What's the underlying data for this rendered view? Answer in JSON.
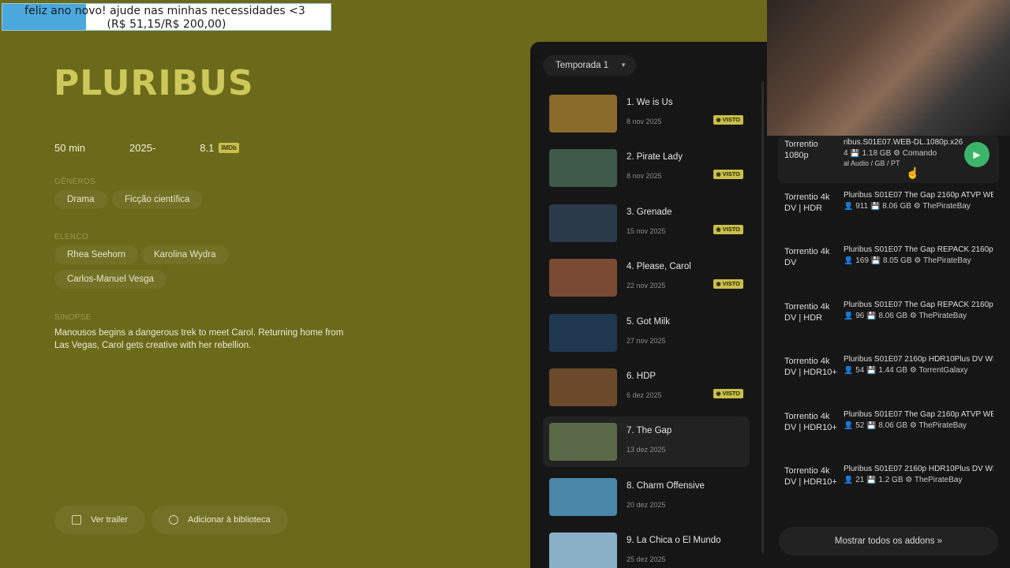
{
  "donation": {
    "line1": "feliz ano novo! ajude nas minhas necessidades <3",
    "line2": "(R$ 51,15/R$ 200,00)",
    "progress": 0.2558,
    "colors": {
      "fill": "#4aa8dc",
      "background": "#ffffff"
    }
  },
  "show": {
    "title": "PLURIBUS",
    "runtime": "50 min",
    "years": "2025-",
    "rating": "8.1",
    "rating_badge": "IMDb",
    "genres_label": "GÊNEROS",
    "genres": [
      "Drama",
      "Ficção científica"
    ],
    "cast_label": "ELENCO",
    "cast": [
      "Rhea Seehorn",
      "Karolina Wydra",
      "Carlos-Manuel Vesga"
    ],
    "synopsis_label": "SINOPSE",
    "synopsis": "Manousos begins a dangerous trek to meet Carol. Returning home from Las Vegas, Carol gets creative with her rebellion.",
    "actions": {
      "trailer": "Ver trailer",
      "library": "Adicionar à biblioteca"
    }
  },
  "episodes": {
    "season": "Temporada 1",
    "watched_label": "VISTO",
    "items": [
      {
        "title": "1. We is Us",
        "date": "8 nov 2025",
        "watched": true,
        "thumb": "#8a6a2a"
      },
      {
        "title": "2. Pirate Lady",
        "date": "8 nov 2025",
        "watched": true,
        "thumb": "#3f5a4a"
      },
      {
        "title": "3. Grenade",
        "date": "15 nov 2025",
        "watched": true,
        "thumb": "#2a3a4a"
      },
      {
        "title": "4. Please, Carol",
        "date": "22 nov 2025",
        "watched": true,
        "thumb": "#7a4a32"
      },
      {
        "title": "5. Got Milk",
        "date": "27 nov 2025",
        "watched": false,
        "thumb": "#1f3850"
      },
      {
        "title": "6. HDP",
        "date": "6 dez 2025",
        "watched": true,
        "thumb": "#6a4a2a"
      },
      {
        "title": "7. The Gap",
        "date": "13 dez 2025",
        "watched": false,
        "thumb": "#5a6a48",
        "selected": true
      },
      {
        "title": "8. Charm Offensive",
        "date": "20 dez 2025",
        "watched": false,
        "thumb": "#4a86a8"
      },
      {
        "title": "9. La Chica o El Mundo",
        "date": "25 dez 2025",
        "watched": false,
        "thumb": "#8ab0c8"
      }
    ]
  },
  "streams": {
    "active": {
      "name": "Torrentio 1080p",
      "file": "ribus.S01E07.WEB-DL.1080p.x26",
      "info": "4 💾 1.18 GB ⚙ Comando",
      "sub": "al Audio / GB / PT",
      "play_icon": "play-icon"
    },
    "items": [
      {
        "name": "Torrentio 4k DV | HDR",
        "file": "Pluribus S01E07 The Gap 2160p ATVP WE",
        "seeders": "911",
        "size": "8.06 GB",
        "source": "ThePirateBay"
      },
      {
        "name": "Torrentio 4k DV",
        "file": "Pluribus S01E07 The Gap REPACK 2160p.",
        "seeders": "169",
        "size": "8.05 GB",
        "source": "ThePirateBay"
      },
      {
        "name": "Torrentio 4k DV | HDR",
        "file": "Pluribus S01E07 The Gap REPACK 2160p.",
        "seeders": "96",
        "size": "8.06 GB",
        "source": "ThePirateBay"
      },
      {
        "name": "Torrentio 4k DV | HDR10+",
        "file": "Pluribus S01E07 2160p HDR10Plus DV WE",
        "seeders": "54",
        "size": "1.44 GB",
        "source": "TorrentGalaxy"
      },
      {
        "name": "Torrentio 4k DV | HDR10+",
        "file": "Pluribus S01E07 The Gap 2160p ATVP WE",
        "seeders": "52",
        "size": "8.06 GB",
        "source": "ThePirateBay"
      },
      {
        "name": "Torrentio 4k DV | HDR10+",
        "file": "Pluribus S01E07 2160p HDR10Plus DV WE",
        "seeders": "21",
        "size": "1.2 GB",
        "source": "ThePirateBay"
      }
    ],
    "show_all": "Mostrar todos os addons »"
  },
  "colors": {
    "background": "#6b6a1b",
    "accent": "#c9bf4a",
    "panel": "#161616",
    "play": "#3bb56a"
  }
}
